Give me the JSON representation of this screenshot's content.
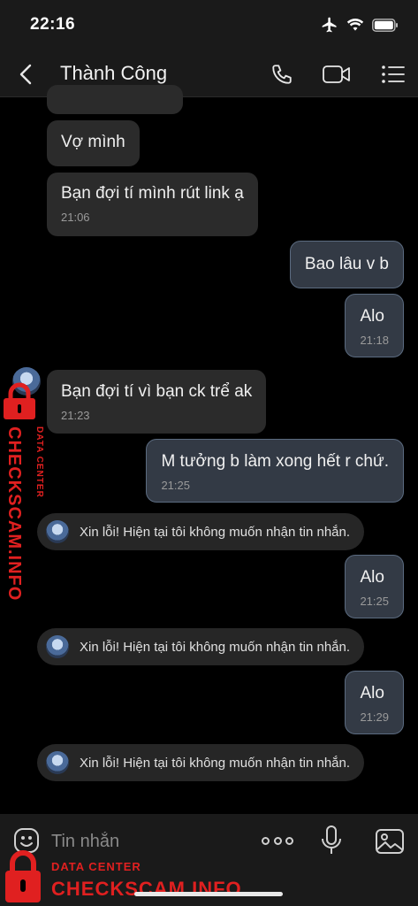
{
  "status_bar": {
    "time": "22:16",
    "icons": [
      "airplane-icon",
      "wifi-icon",
      "battery-icon"
    ]
  },
  "header": {
    "contact_name": "Thành Công",
    "icons": [
      "back-icon",
      "phone-icon",
      "video-call-icon",
      "menu-list-icon"
    ]
  },
  "messages": [
    {
      "dir": "in",
      "text": "Vợ mình",
      "time": ""
    },
    {
      "dir": "in",
      "text": "Bạn đợi tí mình rút link ạ",
      "time": "21:06"
    },
    {
      "dir": "out",
      "text": "Bao lâu v b",
      "time": ""
    },
    {
      "dir": "out",
      "text": "Alo",
      "time": "21:18"
    },
    {
      "dir": "in",
      "text": "Bạn đợi tí vì bạn ck trể ak",
      "time": "21:23"
    },
    {
      "dir": "out",
      "text": "M tưởng b làm xong hết r chứ.",
      "time": "21:25"
    },
    {
      "dir": "system",
      "text": "Xin lỗi! Hiện tại tôi không muốn nhận tin nhắn."
    },
    {
      "dir": "out",
      "text": "Alo",
      "time": "21:25"
    },
    {
      "dir": "system",
      "text": "Xin lỗi! Hiện tại tôi không muốn nhận tin nhắn."
    },
    {
      "dir": "out",
      "text": "Alo",
      "time": "21:29"
    },
    {
      "dir": "system",
      "text": "Xin lỗi! Hiện tại tôi không muốn nhận tin nhắn."
    }
  ],
  "input_bar": {
    "placeholder": "Tin nhắn",
    "icons": [
      "emoji-icon",
      "more-icon",
      "microphone-icon",
      "image-icon"
    ]
  },
  "watermark": {
    "sub": "DATA CENTER",
    "main": "CHECKSCAM.INFO"
  },
  "colors": {
    "background": "#000000",
    "incoming_bubble": "#2b2b2b",
    "outgoing_bubble": "#333a45",
    "watermark": "#e02020"
  }
}
